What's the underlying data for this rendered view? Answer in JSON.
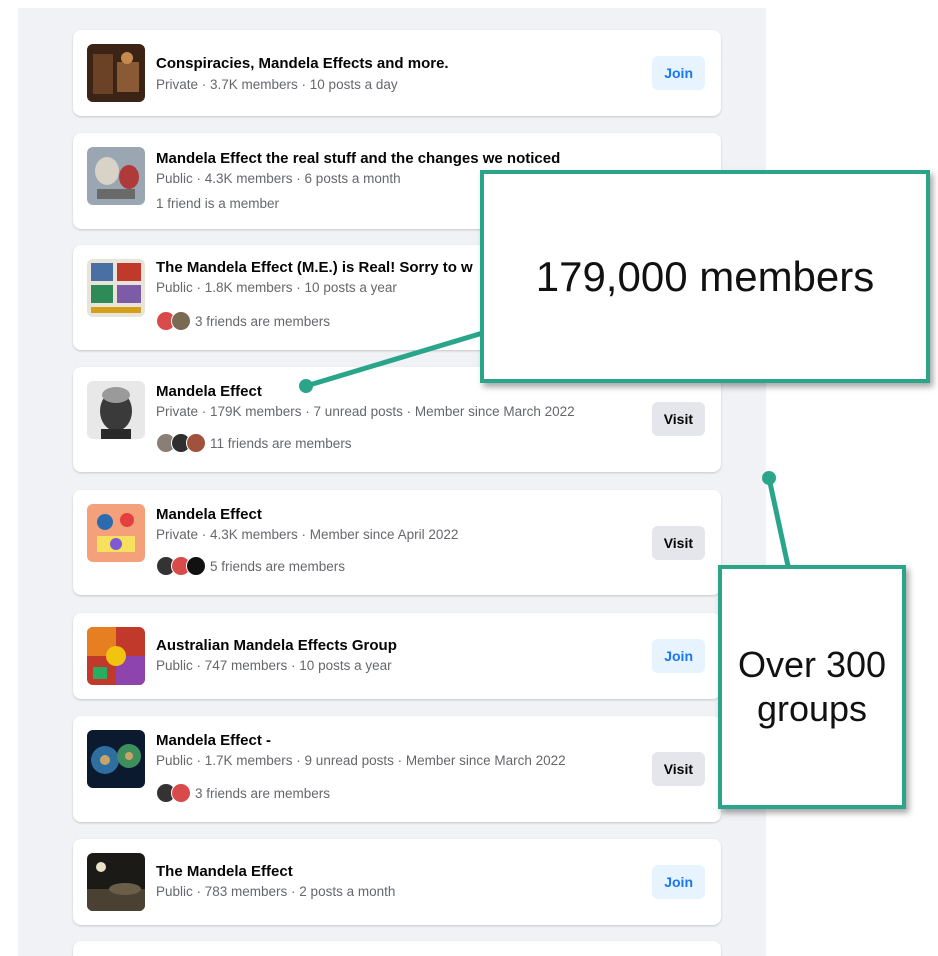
{
  "groups": [
    {
      "name": "Conspiracies, Mandela Effects and more.",
      "meta": "Private · 3.7K members · 10 posts a day",
      "friends": "",
      "button": "Join"
    },
    {
      "name": "Mandela Effect the real stuff and the changes we noticed",
      "meta": "Public · 4.3K members · 6 posts a month",
      "friends": "1 friend is a member",
      "button": ""
    },
    {
      "name": "The Mandela Effect (M.E.) is Real! Sorry to w",
      "meta": "Public · 1.8K members · 10 posts a year",
      "friends": "3 friends are members",
      "button": ""
    },
    {
      "name": "Mandela Effect",
      "meta": "Private · 179K members · 7 unread posts · Member since March 2022",
      "friends": "11 friends are members",
      "button": "Visit"
    },
    {
      "name": "Mandela Effect",
      "meta": "Private · 4.3K members · Member since April 2022",
      "friends": "5 friends are members",
      "button": "Visit"
    },
    {
      "name": "Australian Mandela Effects Group",
      "meta": "Public · 747 members · 10 posts a year",
      "friends": "",
      "button": "Join"
    },
    {
      "name": "Mandela Effect -",
      "meta": "Public · 1.7K members · 9 unread posts · Member since March 2022",
      "friends": "3 friends are members",
      "button": "Visit"
    },
    {
      "name": "The Mandela Effect",
      "meta": "Public · 783 members · 2 posts a month",
      "friends": "",
      "button": "Join"
    }
  ],
  "callouts": {
    "members": "179,000 members",
    "groups_line1": "Over 300",
    "groups_line2": "groups"
  },
  "colors": {
    "callout_border": "#2aa58a",
    "join_bg": "#e7f3ff",
    "join_text": "#1877f2",
    "visit_bg": "#e4e6eb",
    "feed_bg": "#f0f2f5"
  }
}
